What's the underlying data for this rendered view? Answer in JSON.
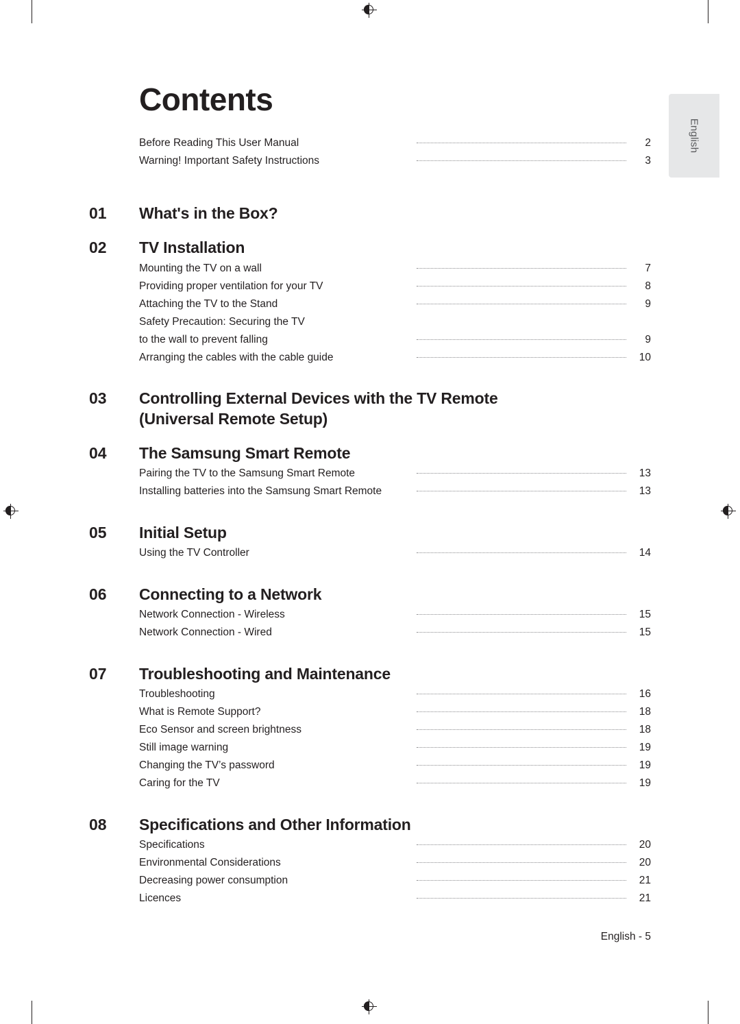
{
  "document": {
    "title": "Contents",
    "language_tab": "English",
    "footer": "English - 5"
  },
  "toc": {
    "preface": [
      {
        "text": "Before Reading This User Manual",
        "page": "2"
      },
      {
        "text": "Warning! Important Safety Instructions",
        "page": "3"
      }
    ],
    "groups": [
      {
        "number": "01",
        "title": "What's in the Box?",
        "entries": []
      },
      {
        "number": "02",
        "title": "TV Installation",
        "entries": [
          {
            "text": "Mounting the TV on a wall",
            "page": "7"
          },
          {
            "text": "Providing proper ventilation for your TV",
            "page": "8"
          },
          {
            "text": "Attaching the TV to the Stand",
            "page": "9"
          },
          {
            "text": "Safety Precaution: Securing the TV",
            "page": ""
          },
          {
            "text": "to the wall to prevent falling",
            "page": "9"
          },
          {
            "text": "Arranging the cables with the cable guide",
            "page": "10"
          }
        ]
      },
      {
        "number": "03",
        "title": "Controlling External Devices with the TV Remote (Universal Remote Setup)",
        "entries": []
      },
      {
        "number": "04",
        "title": "The Samsung Smart Remote",
        "entries": [
          {
            "text": "Pairing the TV to the Samsung Smart Remote",
            "page": "13"
          },
          {
            "text": "Installing batteries into the Samsung Smart Remote",
            "page": "13"
          }
        ]
      },
      {
        "number": "05",
        "title": "Initial Setup",
        "entries": [
          {
            "text": "Using the TV Controller",
            "page": "14"
          }
        ]
      },
      {
        "number": "06",
        "title": "Connecting to a Network",
        "entries": [
          {
            "text": "Network Connection - Wireless",
            "page": "15"
          },
          {
            "text": "Network Connection - Wired",
            "page": "15"
          }
        ]
      },
      {
        "number": "07",
        "title": "Troubleshooting and Maintenance",
        "entries": [
          {
            "text": "Troubleshooting",
            "page": "16"
          },
          {
            "text": "What is Remote Support?",
            "page": "18"
          },
          {
            "text": "Eco Sensor and screen brightness",
            "page": "18"
          },
          {
            "text": "Still image warning",
            "page": "19"
          },
          {
            "text": "Changing the TV’s password",
            "page": "19"
          },
          {
            "text": "Caring for the TV",
            "page": "19"
          }
        ]
      },
      {
        "number": "08",
        "title": "Specifications and Other Information",
        "entries": [
          {
            "text": "Specifications",
            "page": "20"
          },
          {
            "text": "Environmental Considerations",
            "page": "20"
          },
          {
            "text": "Decreasing power consumption",
            "page": "21"
          },
          {
            "text": "Licences",
            "page": "21"
          }
        ]
      }
    ]
  }
}
